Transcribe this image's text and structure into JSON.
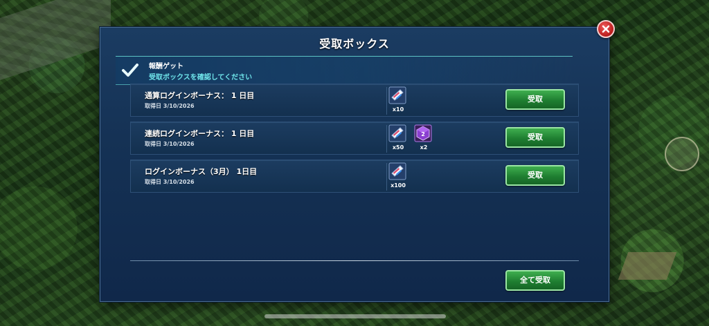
{
  "dialog": {
    "title": "受取ボックス",
    "banner_title": "報酬ゲット",
    "banner_subtitle": "受取ボックスを確認してください",
    "claim_all_label": "全て受取"
  },
  "rewards": [
    {
      "title": "通算ログインボーナス： 1 日目",
      "date": "取得日 3/10/2026",
      "items": [
        {
          "icon": "ticket-icon",
          "count": "x10"
        }
      ],
      "claim_label": "受取"
    },
    {
      "title": "連続ログインボーナス： 1 日目",
      "date": "取得日 3/10/2026",
      "items": [
        {
          "icon": "ticket-icon",
          "count": "x50"
        },
        {
          "icon": "purple-die-icon",
          "count": "x2"
        }
      ],
      "claim_label": "受取"
    },
    {
      "title": "ログインボーナス（3月） 1日目",
      "date": "取得日 3/10/2026",
      "items": [
        {
          "icon": "ticket-icon",
          "count": "x100"
        }
      ],
      "claim_label": "受取"
    }
  ],
  "colors": {
    "panel": "#153255",
    "accent_cyan": "#6fe4ea",
    "button_green": "#1f7f31",
    "close_red": "#b81b1b"
  }
}
